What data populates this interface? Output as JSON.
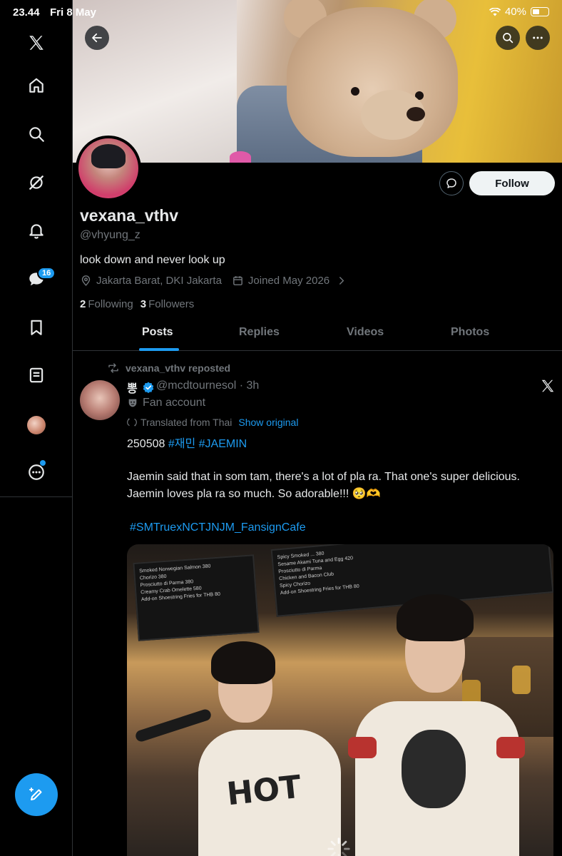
{
  "status_bar": {
    "time": "23.44",
    "date": "Fri 8 May",
    "battery": "40%"
  },
  "sidebar": {
    "items": [
      {
        "name": "x-logo-icon"
      },
      {
        "name": "home-icon"
      },
      {
        "name": "search-icon"
      },
      {
        "name": "grok-icon"
      },
      {
        "name": "notifications-icon"
      },
      {
        "name": "messages-icon",
        "badge": "16"
      },
      {
        "name": "bookmarks-icon"
      },
      {
        "name": "lists-icon"
      },
      {
        "name": "profile-avatar"
      },
      {
        "name": "more-icon"
      }
    ]
  },
  "profile": {
    "display_name": "vexana_vthv",
    "handle": "@vhyung_z",
    "bio": "look down and never look up",
    "location": "Jakarta Barat, DKI Jakarta",
    "joined": "Joined May 2026",
    "following_count": "2",
    "following_label": "Following",
    "followers_count": "3",
    "followers_label": "Followers",
    "follow_label": "Follow"
  },
  "tabs": [
    {
      "label": "Posts",
      "active": true
    },
    {
      "label": "Replies",
      "active": false
    },
    {
      "label": "Videos",
      "active": false
    },
    {
      "label": "Photos",
      "active": false
    }
  ],
  "tweet": {
    "repost_text": "vexana_vthv reposted",
    "author_name": "뽕",
    "author_handle": "@mcdtournesol · 3h",
    "label": "Fan account",
    "translated_text": "Translated from Thai",
    "show_original": "Show original",
    "line1_text": "250508",
    "line1_tags": "#재민 #JAEMIN",
    "body": "Jaemin said that in som tam, there's a lot of pla ra. That one's super delicious. Jaemin loves pla ra so much. So adorable!!! 🥺🫶",
    "hashtag": "#SMTruexNCTJNJM_FansignCafe"
  },
  "photo": {
    "menu_left": [
      "Smoked Norwegian Salmon 380",
      "Chorizo 380",
      "Prosciutto di Parma 380",
      "Creamy Crab Omelette 580",
      "Add-on Shoestring Fries for THB 80"
    ],
    "menu_right": [
      "Spicy Smoked ... 380",
      "Sesame Akami Tuna and Egg 420",
      "Prosciutto di Parma",
      "Chicken and Bacon Club",
      "Spicy Chorizo",
      "Add-on Shoestring Fries for THB 80"
    ],
    "shirt_text": "HOT"
  },
  "colors": {
    "accent": "#1d9bf0",
    "background": "#000000",
    "secondary_text": "#71767b",
    "divider": "#2f3336"
  }
}
